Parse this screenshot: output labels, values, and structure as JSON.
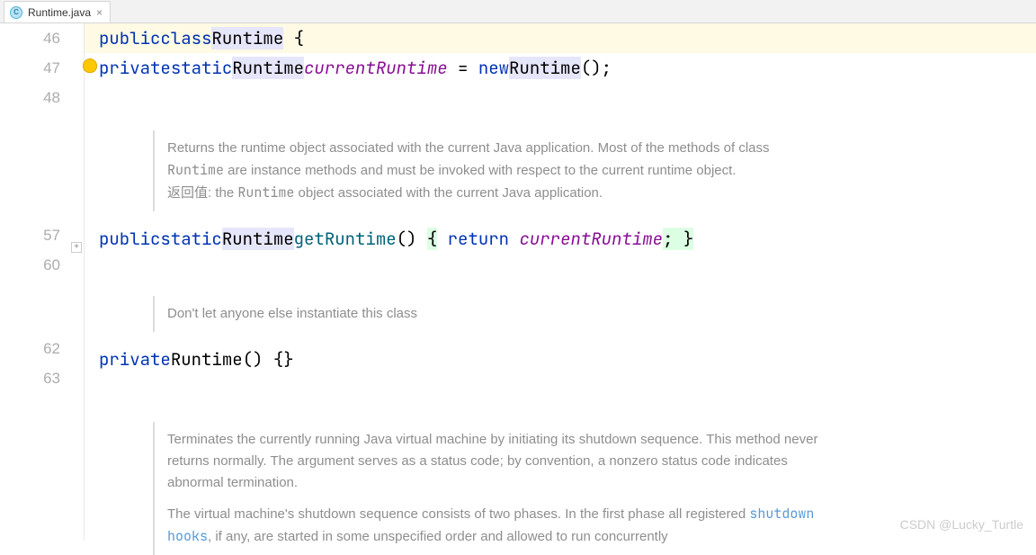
{
  "tab": {
    "filename": "Runtime.java"
  },
  "gutter": {
    "lines": [
      "46",
      "47",
      "48",
      "57",
      "60",
      "62",
      "63"
    ]
  },
  "code": {
    "l46": {
      "kw1": "public",
      "kw2": "class",
      "cls": "Runtime",
      "br": " {"
    },
    "l47": {
      "kw1": "private",
      "kw2": "static",
      "type": "Runtime",
      "field": "currentRuntime",
      "eq": " = ",
      "kw3": "new",
      "ctor": "Runtime",
      "tail": "();"
    },
    "l57": {
      "kw1": "public",
      "kw2": "static",
      "type": "Runtime",
      "fn": "getRuntime",
      "paren": "() ",
      "br1": "{",
      "kw3": " return",
      "field": " currentRuntime",
      "semi": ";",
      "br2": " }"
    },
    "l62": {
      "kw1": "private",
      "ctor": "Runtime",
      "tail": "() {}"
    }
  },
  "docs": {
    "d1a": "Returns the runtime object associated with the current Java application. Most of the methods of class ",
    "d1ref": "Runtime",
    "d1b": " are instance methods and must be invoked with respect to the current runtime object.",
    "d1ret_lbl": "返回值: the ",
    "d1ret_ref": "Runtime",
    "d1ret_tail": " object associated with the current Java application.",
    "d2": "Don't let anyone else instantiate this class",
    "d3a": "Terminates the currently running Java virtual machine by initiating its shutdown sequence. This method never returns normally. The argument serves as a status code; by convention, a nonzero status code indicates abnormal termination.",
    "d3b_pre": "The virtual machine's shutdown sequence consists of two phases. In the first phase all registered ",
    "d3b_link": "shutdown hooks",
    "d3b_post": ", if any, are started in some unspecified order and allowed to run concurrently"
  },
  "watermark": "CSDN @Lucky_Turtle"
}
